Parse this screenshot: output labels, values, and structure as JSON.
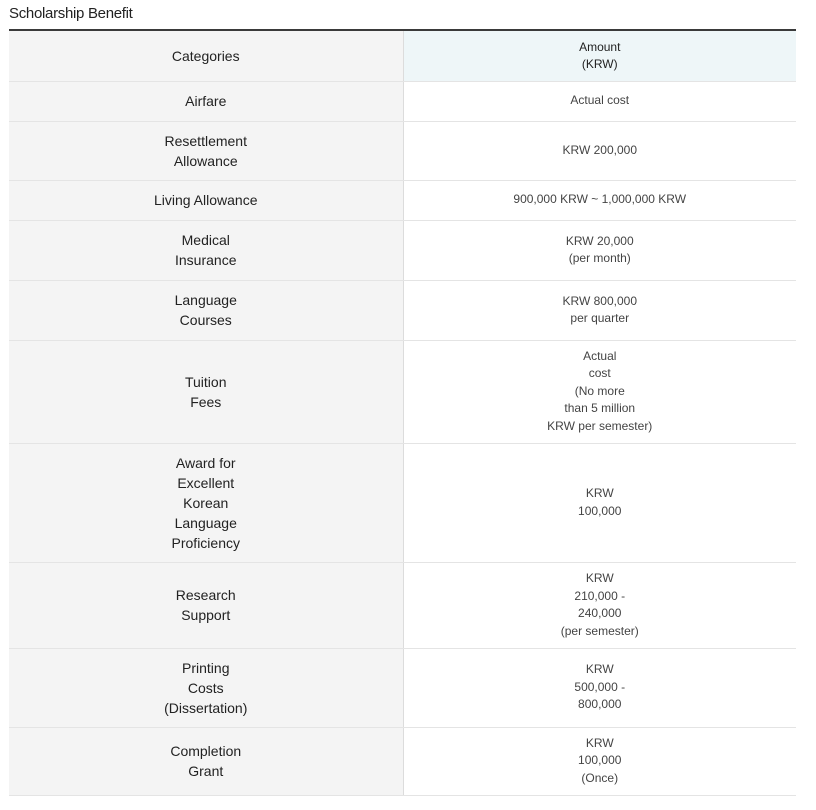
{
  "title": "Scholarship Benefit",
  "table": {
    "headers": {
      "categories": "Categories",
      "amount": "Amount\n(KRW)"
    },
    "rows": [
      {
        "category": "Airfare",
        "amount": "Actual cost"
      },
      {
        "category": "Resettlement\nAllowance",
        "amount": "KRW 200,000"
      },
      {
        "category": "Living Allowance",
        "amount": "900,000 KRW ~ 1,000,000 KRW"
      },
      {
        "category": "Medical\nInsurance",
        "amount": "KRW 20,000\n(per month)"
      },
      {
        "category": "Language\nCourses",
        "amount": "KRW 800,000\nper quarter"
      },
      {
        "category": "Tuition\nFees",
        "amount": "Actual\ncost\n(No more\nthan 5 million\nKRW per semester)"
      },
      {
        "category": "Award for\nExcellent\nKorean\nLanguage\nProficiency",
        "amount": "KRW\n100,000"
      },
      {
        "category": "Research\nSupport",
        "amount": "KRW\n210,000 -\n240,000\n(per semester)"
      },
      {
        "category": "Printing\nCosts\n(Dissertation)",
        "amount": "KRW\n500,000 -\n800,000"
      },
      {
        "category": "Completion\nGrant",
        "amount": "KRW\n100,000\n(Once)"
      }
    ]
  }
}
